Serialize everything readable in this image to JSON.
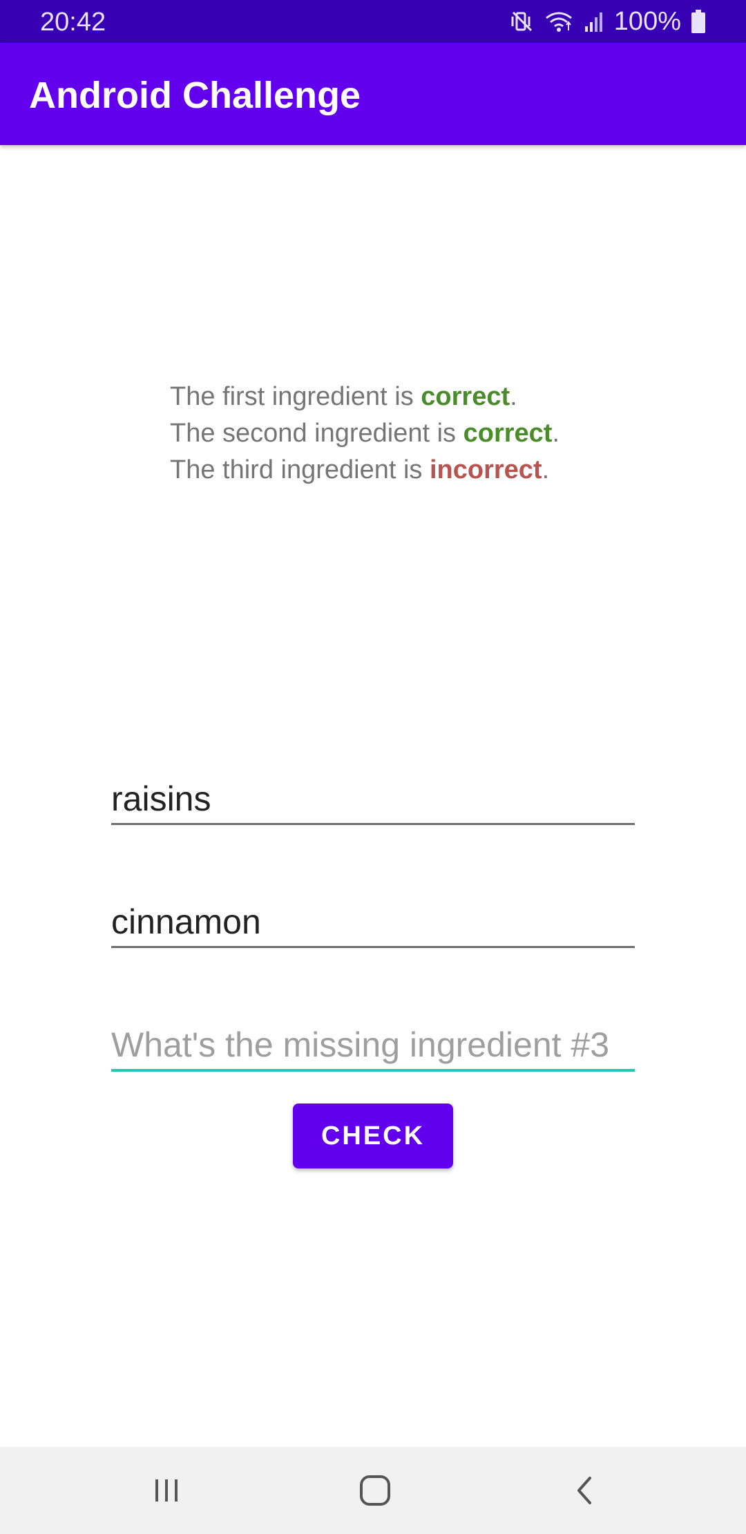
{
  "status_bar": {
    "time": "20:42",
    "battery": "100%",
    "icons": [
      "mute-vibrate-icon",
      "wifi-icon",
      "signal-icon",
      "battery-icon"
    ]
  },
  "app_bar": {
    "title": "Android Challenge"
  },
  "results": {
    "line1_prefix": "The first ingredient is ",
    "line1_status": "correct",
    "line2_prefix": "The second ingredient is ",
    "line2_status": "correct",
    "line3_prefix": "The third ingredient is ",
    "line3_status": "incorrect",
    "suffix": "."
  },
  "inputs": {
    "ingredient1": {
      "value": "raisins"
    },
    "ingredient2": {
      "value": "cinnamon"
    },
    "ingredient3": {
      "value": "",
      "placeholder": "What's the missing ingredient #3"
    }
  },
  "button": {
    "label": "CHECK"
  },
  "nav_bar": {
    "icons": [
      "recents-icon",
      "home-icon",
      "back-icon"
    ]
  },
  "colors": {
    "status_bar": "#3700B3",
    "primary": "#6200EE",
    "correct": "#4A8C2A",
    "incorrect": "#B85450",
    "focus_underline": "#26C6B5"
  }
}
